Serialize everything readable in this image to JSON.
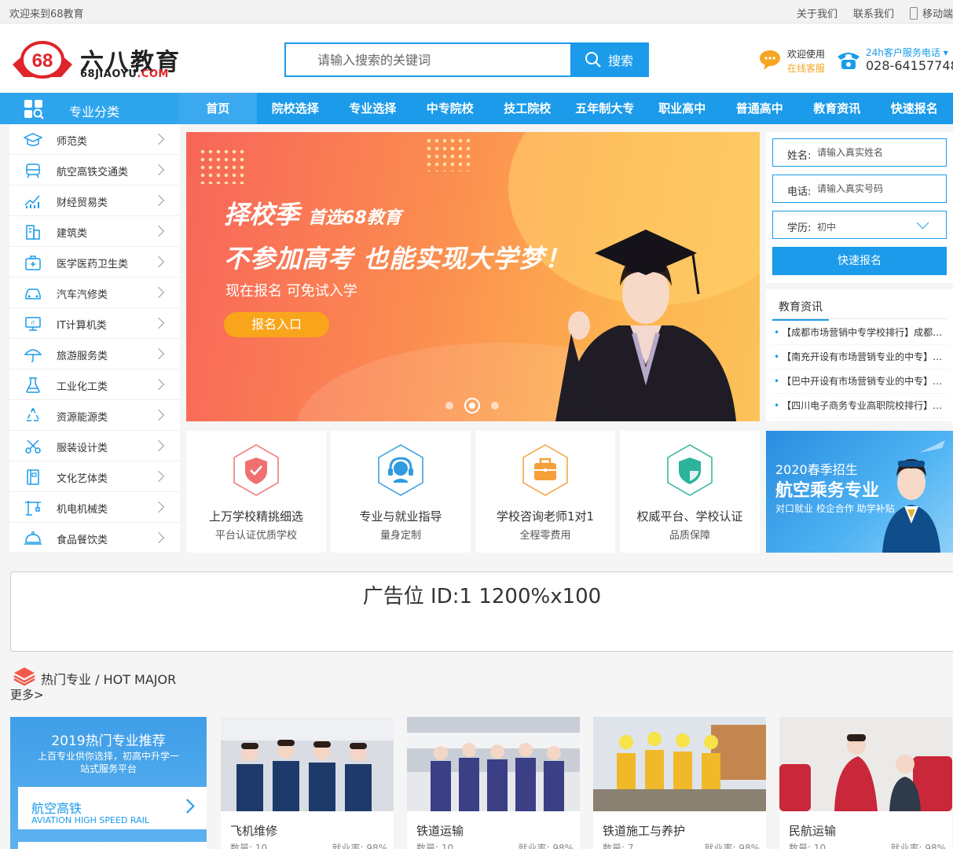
{
  "topbar": {
    "welcome": "欢迎来到68教育",
    "about": "关于我们",
    "contact": "联系我们",
    "mobile": "移动端"
  },
  "header": {
    "logo_badge": "68",
    "logo_cn": "六八教育",
    "logo_en_a": "68JIAOYU",
    "logo_en_b": ".COM",
    "search_placeholder": "请输入搜索的关键词",
    "search_button": "搜索",
    "service_line1": "欢迎使用",
    "service_line2": "在线客服",
    "hotline_label": "24h客户服务电话",
    "hotline_number": "028-64157748"
  },
  "nav": {
    "category_label": "专业分类",
    "items": [
      "首页",
      "院校选择",
      "专业选择",
      "中专院校",
      "技工院校",
      "五年制大专",
      "职业高中",
      "普通高中",
      "教育资讯",
      "快速报名"
    ]
  },
  "categories": [
    {
      "label": "师范类",
      "icon": "graduation-cap-icon"
    },
    {
      "label": "航空高铁交通类",
      "icon": "train-icon"
    },
    {
      "label": "财经贸易类",
      "icon": "chart-icon"
    },
    {
      "label": "建筑类",
      "icon": "building-icon"
    },
    {
      "label": "医学医药卫生类",
      "icon": "medical-kit-icon"
    },
    {
      "label": "汽车汽修类",
      "icon": "car-icon"
    },
    {
      "label": "IT计算机类",
      "icon": "computer-icon"
    },
    {
      "label": "旅游服务类",
      "icon": "umbrella-icon"
    },
    {
      "label": "工业化工类",
      "icon": "flask-icon"
    },
    {
      "label": "资源能源类",
      "icon": "recycle-icon"
    },
    {
      "label": "服装设计类",
      "icon": "scissors-icon"
    },
    {
      "label": "文化艺体类",
      "icon": "book-icon"
    },
    {
      "label": "机电机械类",
      "icon": "crane-icon"
    },
    {
      "label": "食品餐饮类",
      "icon": "food-cover-icon"
    }
  ],
  "banner": {
    "title_a": "择校季",
    "title_b": "首选68教育",
    "headline": "不参加高考 也能实现大学梦！",
    "subline": "现在报名 可免试入学",
    "button": "报名入口",
    "slides": 3,
    "active_slide": 2
  },
  "form": {
    "name_label": "姓名:",
    "name_placeholder": "请输入真实姓名",
    "phone_label": "电话:",
    "phone_placeholder": "请输入真实号码",
    "edu_label": "学历:",
    "edu_value": "初中",
    "submit": "快速报名"
  },
  "news": {
    "title": "教育资讯",
    "items": [
      "【成都市场营销中专学校排行】成都市场营销中专学校排行",
      "【南充开设有市场营销专业的中专】南充开设有市场营销专业的中专",
      "【巴中开设有市场营销专业的中专】巴中开设有市场营销专业的中专",
      "【四川电子商务专业高职院校排行】四川电子商务专业高职院校排行"
    ]
  },
  "features": [
    {
      "title": "上万学校精挑细选",
      "sub": "平台认证优质学校",
      "icon": "shield-check-icon",
      "color": "#f07070"
    },
    {
      "title": "专业与就业指导",
      "sub": "量身定制",
      "icon": "headset-icon",
      "color": "#2f9be0"
    },
    {
      "title": "学校咨询老师1对1",
      "sub": "全程零费用",
      "icon": "briefcase-icon",
      "color": "#f5a03a"
    },
    {
      "title": "权威平台、学校认证",
      "sub": "品质保障",
      "icon": "shield-icon",
      "color": "#2bb39b"
    }
  ],
  "promo": {
    "line1": "2020春季招生",
    "line2": "航空乘务专业",
    "line3": "对口就业 校企合作 助学补贴"
  },
  "ad": {
    "text": "广告位 ID:1 1200%x100"
  },
  "hot": {
    "title": "热门专业 / HOT MAJOR",
    "more": "更多>",
    "rec_title": "2019热门专业推荐",
    "rec_desc": "上百专业供你选择，初高中升学一站式服务平台",
    "rec_item_cn": "航空高铁",
    "rec_item_en": "AVIATION HIGH SPEED RAIL",
    "cards": [
      {
        "name": "飞机维修",
        "count": "数量: 10",
        "rate": "就业率: 98%"
      },
      {
        "name": "铁道运输",
        "count": "数量: 10",
        "rate": "就业率: 98%"
      },
      {
        "name": "铁道施工与养护",
        "count": "数量: 7",
        "rate": "就业率: 98%"
      },
      {
        "name": "民航运输",
        "count": "数量: 10",
        "rate": "就业率: 98%"
      }
    ]
  },
  "colors": {
    "primary": "#1b9bea",
    "accent_orange": "#f9a51b",
    "brand_red": "#e0242b"
  }
}
